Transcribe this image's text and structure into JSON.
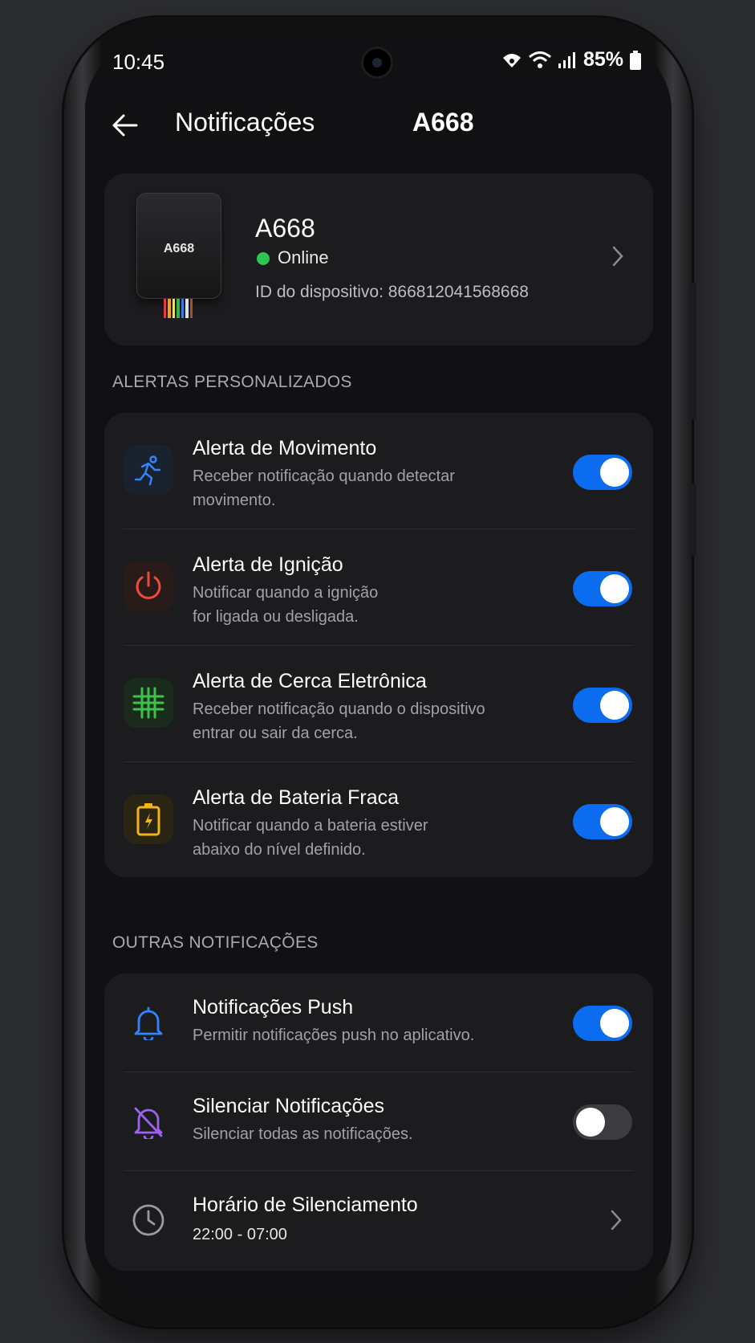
{
  "status_bar": {
    "time": "10:45",
    "battery": "85%"
  },
  "header": {
    "title": "Notificações",
    "device": "A668"
  },
  "device": {
    "label": "A668",
    "name": "A668",
    "status": "Online",
    "id_text": "ID do dispositivo: 866812041568668"
  },
  "section1": {
    "label": "ALERTAS PERSONALIZADOS",
    "items": [
      {
        "title": "Alerta de Movimento",
        "desc1": "Receber notificação quando detectar",
        "desc2": "movimento.",
        "enabled": true
      },
      {
        "title": "Alerta de Ignição",
        "desc1": "Notificar quando a ignição",
        "desc2": "for ligada ou desligada.",
        "enabled": true
      },
      {
        "title": "Alerta de Cerca Eletrônica",
        "desc1": "Receber notificação quando o dispositivo",
        "desc2": "entrar ou sair da cerca.",
        "enabled": true
      },
      {
        "title": "Alerta de Bateria Fraca",
        "desc1": "Notificar quando a bateria estiver",
        "desc2": "abaixo do nível definido.",
        "enabled": true
      }
    ]
  },
  "section2": {
    "label": "OUTRAS NOTIFICAÇÕES",
    "items": [
      {
        "title": "Notificações Push",
        "desc": "Permitir notificações push no aplicativo.",
        "enabled": true
      },
      {
        "title": "Silenciar Notificações",
        "desc": "Silenciar todas as notificações.",
        "enabled": false
      },
      {
        "title": "Horário de Silenciamento",
        "desc": "22:00 - 07:00"
      }
    ]
  },
  "colors": {
    "accent": "#0c6cf0",
    "online": "#2ec451",
    "movement_icon": "#2f86ff",
    "ignition_icon": "#ef4a3c",
    "fence_icon": "#3cc24a",
    "battery_icon": "#f2b418",
    "push_icon": "#2f86ff",
    "silence_icon": "#9a63f0"
  }
}
